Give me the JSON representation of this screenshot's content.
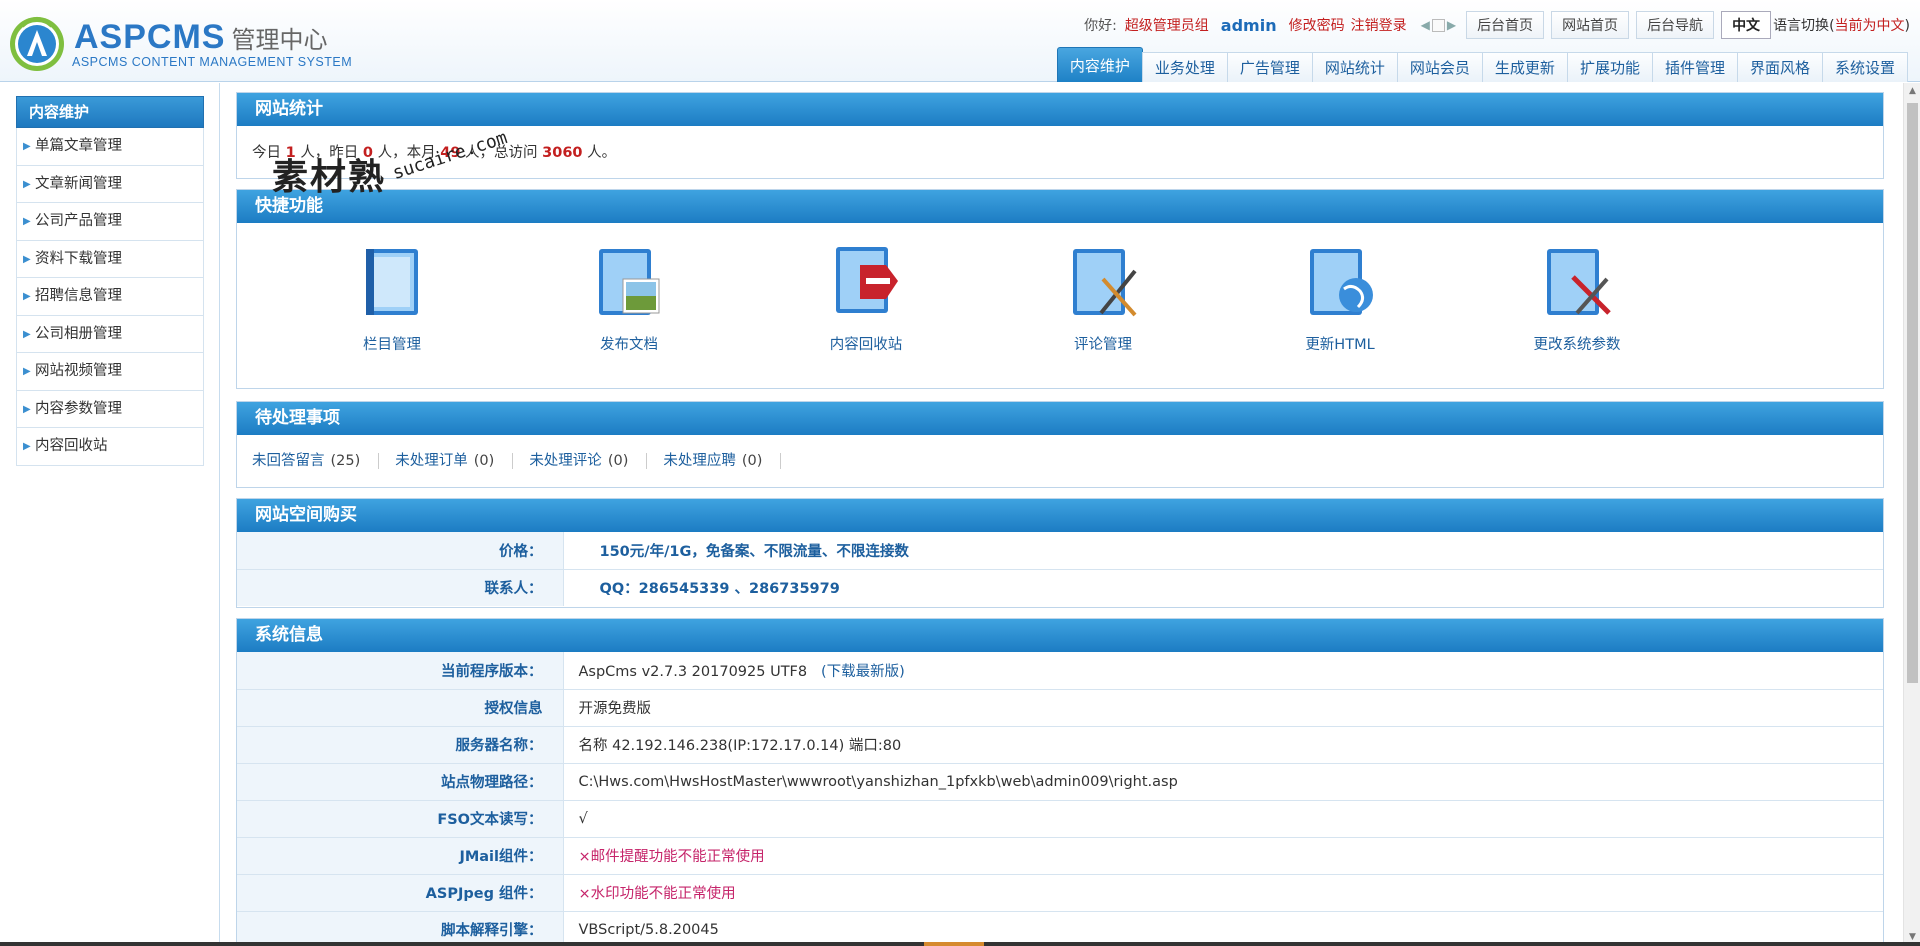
{
  "header": {
    "logo_title": "ASPCMS",
    "logo_cn": "管理中心",
    "logo_sub": "ASPCMS CONTENT MANAGEMENT SYSTEM",
    "greet": "你好:",
    "group": "超级管理员组",
    "user": "admin",
    "change_pwd": "修改密码",
    "logout": "注销登录",
    "buttons": [
      "后台首页",
      "网站首页",
      "后台导航"
    ],
    "lang_btn": "中文",
    "lang_label": "语言切换",
    "lang_open": "(",
    "lang_current": "当前为中文",
    "lang_close": ")"
  },
  "nav": {
    "tabs": [
      "内容维护",
      "业务处理",
      "广告管理",
      "网站统计",
      "网站会员",
      "生成更新",
      "扩展功能",
      "插件管理",
      "界面风格",
      "系统设置"
    ]
  },
  "sidebar": {
    "title": "内容维护",
    "items": [
      "单篇文章管理",
      "文章新闻管理",
      "公司产品管理",
      "资料下载管理",
      "招聘信息管理",
      "公司相册管理",
      "网站视频管理",
      "内容参数管理",
      "内容回收站"
    ]
  },
  "stats": {
    "title": "网站统计",
    "today_label": "今日",
    "today": "1",
    "yesterday_label": "人，昨日",
    "yesterday": "0",
    "month_label": "人，本月",
    "month": "49",
    "total_label": "人，总访问",
    "total": "3060",
    "end": "人。"
  },
  "quick": {
    "title": "快捷功能",
    "items": [
      "栏目管理",
      "发布文档",
      "内容回收站",
      "评论管理",
      "更新HTML",
      "更改系统参数"
    ]
  },
  "todo": {
    "title": "待处理事项",
    "items": [
      {
        "label": "未回答留言",
        "count": "(25)"
      },
      {
        "label": "未处理订单",
        "count": "(0)"
      },
      {
        "label": "未处理评论",
        "count": "(0)"
      },
      {
        "label": "未处理应聘",
        "count": "(0)"
      }
    ]
  },
  "buy": {
    "title": "网站空间购买",
    "rows": [
      {
        "k": "价格：",
        "v": "150元/年/1G，免备案、不限流量、不限连接数"
      },
      {
        "k": "联系人：",
        "v": "QQ：286545339 、286735979"
      }
    ]
  },
  "sysinfo": {
    "title": "系统信息",
    "version_k": "当前程序版本：",
    "version_v": "AspCms v2.7.3 20170925 UTF8",
    "version_link": "(下载最新版)",
    "license_k": "授权信息",
    "license_v": "开源免费版",
    "server_k": "服务器名称：",
    "server_v": "名称 42.192.146.238(IP:172.17.0.14) 端口:80",
    "path_k": "站点物理路径：",
    "path_v": "C:\\Hws.com\\HwsHostMaster\\wwwroot\\yanshizhan_1pfxkb\\web\\admin009\\right.asp",
    "fso_k": "FSO文本读写：",
    "fso_v": "√",
    "jmail_k": "JMail组件：",
    "jmail_v": "×邮件提醒功能不能正常使用",
    "aspjpeg_k": "ASPJpeg 组件：",
    "aspjpeg_v": "×水印功能不能正常使用",
    "script_k": "脚本解释引擎：",
    "script_v": "VBScript/5.8.20045"
  },
  "watermark": {
    "cn": "素材熟",
    "en": "sucaire.com"
  },
  "colors": {
    "accent": "#1e81c6",
    "red": "#c31f1f",
    "link": "#1d5f9e"
  }
}
